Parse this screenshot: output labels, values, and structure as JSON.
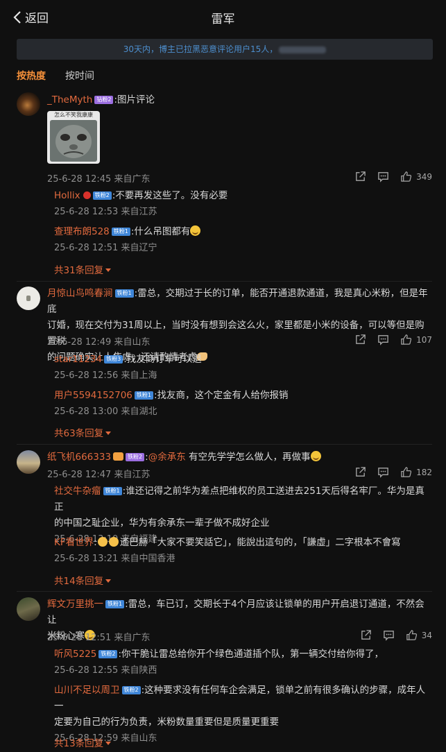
{
  "header": {
    "back_label": "返回",
    "title": "雷军"
  },
  "notice": {
    "text": "30天内，博主已拉黑恶意评论用户15人，"
  },
  "sort_tabs": [
    {
      "label": "按热度",
      "active": true
    },
    {
      "label": "按时间",
      "active": false
    }
  ],
  "comments": [
    {
      "user": "_TheMyth",
      "badge": "钻粉2",
      "text": ":图片评论",
      "image_caption": "怎么不笑我康康",
      "meta": "25-6-28 12:45 来自广东",
      "likes": "349",
      "replies": [
        {
          "user": "Hollix",
          "badge": "铁粉2",
          "text": ":不要再发这些了。没有必要",
          "meta": "25-6-28 12:53 来自江苏"
        },
        {
          "user": "查理布朗528",
          "badge": "铁粉1",
          "text": ":什么吊图都有",
          "meta": "25-6-28 12:51 来自辽宁"
        }
      ],
      "more_replies": "共31条回复"
    },
    {
      "user": "月惊山鸟鸣春涧",
      "badge": "铁粉1",
      "text_1": ":雷总，交期过于长的订单，能否开通退款通道，我是真心米粉，但是年底",
      "text_2": "订婚，现在交付为31周以上，当时没有想到会这么火，家里都是小米的设备，可以等但是购置税",
      "text_3": "的问题确实让人焦虑，还请酌情考虑",
      "meta": "25-6-28 12:49 来自山东",
      "likes": "107",
      "replies": [
        {
          "user": "star11234",
          "badge": "铁粉3",
          "text": ":找友商订车可以退",
          "meta": "25-6-28 12:56 来自上海"
        },
        {
          "user": "用户5594152706",
          "badge": "铁粉1",
          "text": ":找友商，这个定金有人给你报销",
          "meta": "25-6-28 13:00 来自湖北"
        }
      ],
      "more_replies": "共63条回复"
    },
    {
      "user": "纸飞机666333",
      "badge": "铁粉2",
      "text": ":@余承东 有空先学学怎么做人，再做事",
      "mention": "@余承东",
      "text_tail": " 有空先学学怎么做人，再做事",
      "meta": "25-6-28 12:47 来自江苏",
      "likes": "182",
      "replies": [
        {
          "user": "社交牛杂瘤",
          "badge": "铁粉1",
          "text_1": ":谁还记得之前华为差点把维权的员工送进去251天后得名牢厂。华为是真正",
          "text_2": "的中国之耻企业，华为有余承东一辈子做不成好企业",
          "meta": "25-6-28 13:10 来自福建"
        },
        {
          "user": "KF看世界",
          "badge": "",
          "text": "遙巴赫「大家不要笑話它」，能說出這句的，「謙虛」二字根本不會寫",
          "meta": "25-6-28 13:21 来自中国香港"
        }
      ],
      "more_replies": "共14条回复"
    },
    {
      "user": "辉文万里挑一",
      "badge": "铁粉1",
      "text_1": ":雷总，车已订，交期长于4个月应该让锁单的用户开启退订通道，不然会让",
      "text_2": "米粉心寒",
      "meta": "25-6-28 12:51 来自广东",
      "likes": "34",
      "replies": [
        {
          "user": "听风5225",
          "badge": "铁粉2",
          "text": ":你干脆让雷总给你开个绿色通道插个队，第一辆交付给你得了，",
          "meta": "25-6-28 12:55 来自陕西"
        },
        {
          "user": "山川不足以周卫",
          "badge": "铁粉2",
          "text_1": ":这种要求没有任何车企会满足，锁单之前有很多确认的步骤，成年人一",
          "text_2": "定要为自己的行为负责，米粉数量重要但是质量更重要",
          "meta": "25-6-28 12:59 来自山东"
        }
      ],
      "more_replies": "共13条回复"
    }
  ],
  "colors": {
    "accent_orange": "#e26a3e",
    "notice_blue": "#4d8fcf",
    "background": "#101010"
  },
  "icons": [
    "chevron-left-icon",
    "share-icon",
    "comment-icon",
    "like-icon"
  ]
}
